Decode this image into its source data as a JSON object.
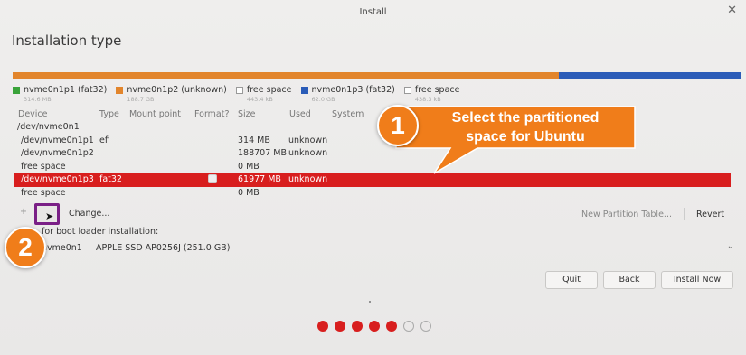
{
  "window": {
    "title": "Install",
    "close_glyph": "✕"
  },
  "page_title": "Installation type",
  "partition_bar": {
    "colors": {
      "fat32_green": "#3aa33a",
      "unknown_orange": "#e2852c",
      "free_white": "#ffffff",
      "fat32_blue": "#2b5cb8"
    }
  },
  "legend": [
    {
      "label": "nvme0n1p1 (fat32)",
      "color": "#3aa33a",
      "sub": "314.6 MB"
    },
    {
      "label": "nvme0n1p2 (unknown)",
      "color": "#e2852c",
      "sub": "188.7 GB"
    },
    {
      "label": "free space",
      "color": "#ffffff",
      "sub": "443.4 kB"
    },
    {
      "label": "nvme0n1p3 (fat32)",
      "color": "#2b5cb8",
      "sub": "62.0 GB"
    },
    {
      "label": "free space",
      "color": "#ffffff",
      "sub": "438.3 kB"
    }
  ],
  "table": {
    "headers": [
      "Device",
      "Type",
      "Mount point",
      "Format?",
      "Size",
      "Used",
      "System"
    ],
    "rows": [
      {
        "device": "/dev/nvme0n1",
        "type": "",
        "size": "",
        "used": ""
      },
      {
        "device": "/dev/nvme0n1p1",
        "type": "efi",
        "size": "314 MB",
        "used": "unknown"
      },
      {
        "device": "/dev/nvme0n1p2",
        "type": "",
        "size": "188707 MB",
        "used": "unknown"
      },
      {
        "device": "free space",
        "type": "",
        "size": "0 MB",
        "used": ""
      },
      {
        "device": "/dev/nvme0n1p3",
        "type": "fat32",
        "size": "61977 MB",
        "used": "unknown"
      },
      {
        "device": "free space",
        "type": "",
        "size": "0 MB",
        "used": ""
      }
    ]
  },
  "controls": {
    "add": "+",
    "remove": "−",
    "change": "Change...",
    "new_partition_table": "New Partition Table...",
    "revert": "Revert"
  },
  "boot_loader": {
    "label": "for boot loader installation:",
    "device": "nvme0n1",
    "description": "APPLE SSD AP0256J (251.0 GB)"
  },
  "buttons": {
    "quit": "Quit",
    "back": "Back",
    "install_now": "Install Now"
  },
  "progress_dots": {
    "filled": 5,
    "total": 7,
    "accent": "#d81e1e"
  },
  "annotations": {
    "step1_number": "1",
    "step1_text_line1": "Select the partitioned",
    "step1_text_line2": "space for Ubuntu",
    "step2_number": "2",
    "callout_color": "#f07d1a",
    "highlight_color": "#7a1f86"
  }
}
